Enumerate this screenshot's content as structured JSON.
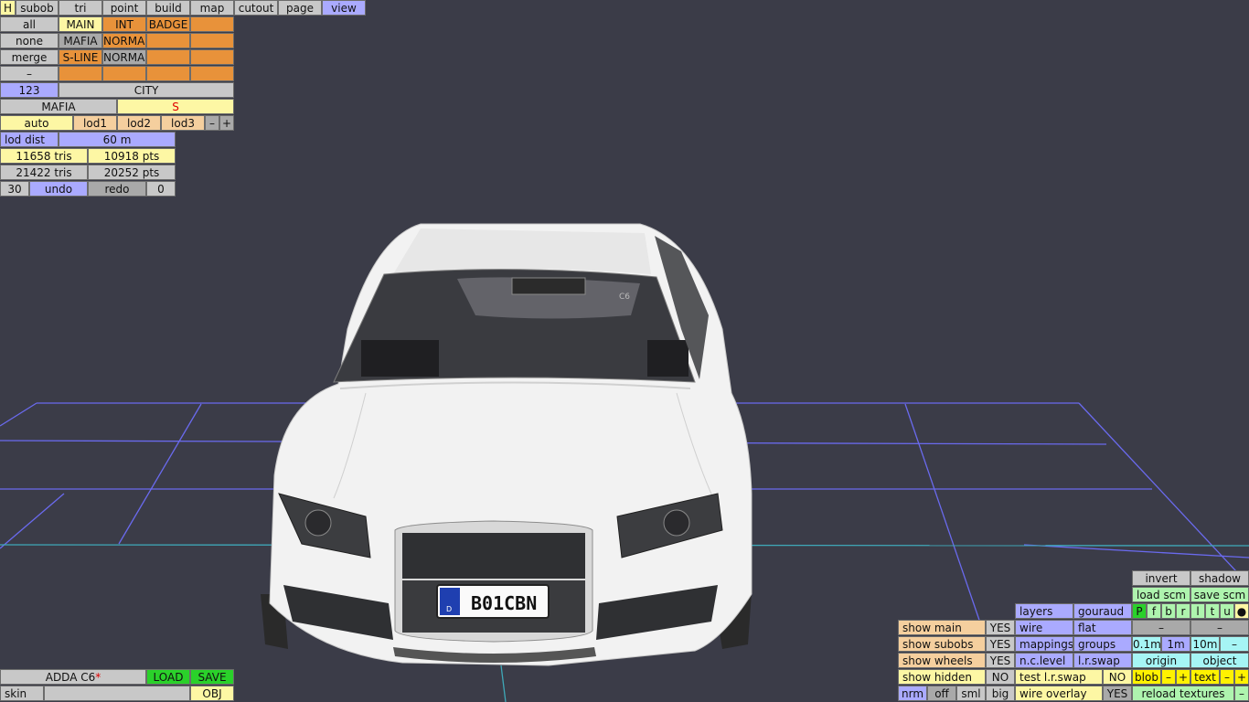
{
  "top_menu": {
    "h": "H",
    "subob": "subob",
    "tri": "tri",
    "point": "point",
    "build": "build",
    "map": "map",
    "cutout": "cutout",
    "page": "page",
    "view": "view"
  },
  "subob_panel": {
    "all": "all",
    "main": "MAIN",
    "int": "INT",
    "badge": "BADGE",
    "none": "none",
    "mafia": "MAFIA",
    "normal1": "NORMAL",
    "merge": "merge",
    "sline": "S-LINE",
    "normal2": "NORMAL",
    "dash": "–",
    "num": "123",
    "city": "CITY",
    "mafia2": "MAFIA",
    "s": "S",
    "auto": "auto",
    "lod1": "lod1",
    "lod2": "lod2",
    "lod3": "lod3",
    "minus": "–",
    "plus": "+"
  },
  "stats": {
    "lod_dist_label": "lod dist",
    "lod_dist_value": "60 m",
    "tris1": "11658 tris",
    "pts1": "10918 pts",
    "tris2": "21422 tris",
    "pts2": "20252 pts",
    "undo_count": "30",
    "undo": "undo",
    "redo": "redo",
    "redo_count": "0"
  },
  "bottom_left": {
    "model_name": "ADDA C6",
    "modified_mark": "*",
    "load": "LOAD",
    "save": "SAVE",
    "skin": "skin",
    "obj": "OBJ"
  },
  "view_options": {
    "rows": [
      {
        "label": "show main",
        "value": "YES"
      },
      {
        "label": "show subobs",
        "value": "YES"
      },
      {
        "label": "show wheels",
        "value": "YES"
      },
      {
        "label": "show hidden",
        "value": "NO"
      }
    ],
    "nrm": "nrm",
    "off": "off",
    "sml": "sml",
    "big": "big"
  },
  "render_panel": {
    "layers": "layers",
    "gouraud": "gouraud",
    "wire": "wire",
    "flat": "flat",
    "mappings": "mappings",
    "groups": "groups",
    "nclevel": "n.c.level",
    "lrswap": "l.r.swap",
    "test_lrswap": "test l.r.swap",
    "test_lrswap_value": "NO",
    "wire_overlay": "wire overlay",
    "wire_overlay_value": "YES"
  },
  "right_panel": {
    "invert": "invert",
    "shadow": "shadow",
    "load_scm": "load scm",
    "save_scm": "save scm",
    "letters": [
      "P",
      "f",
      "b",
      "r",
      "l",
      "t",
      "u",
      "●"
    ],
    "dash": "–",
    "scale_01": "0.1m",
    "scale_1": "1m",
    "scale_10": "10m",
    "origin": "origin",
    "object": "object",
    "blob": "blob",
    "text": "text",
    "minus": "–",
    "plus": "+",
    "reload_textures": "reload textures"
  },
  "scene": {
    "license_plate": "B01CBN",
    "plate_country": "D",
    "badge": "C6",
    "colors": {
      "background": "#3b3c48",
      "grid": "#6c6cf0",
      "grid_cyan": "#3fa8b8",
      "car_body": "#f2f2f2"
    }
  }
}
